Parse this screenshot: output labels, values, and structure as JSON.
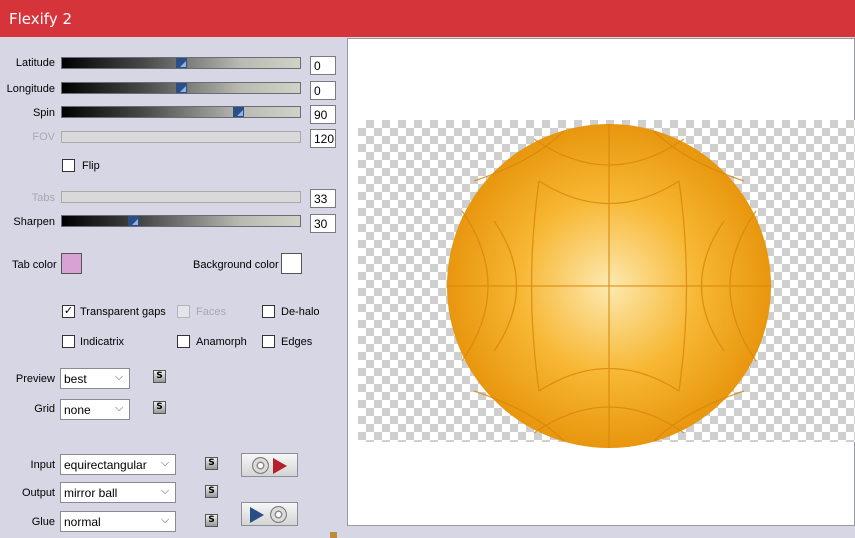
{
  "window": {
    "title": "Flexify 2"
  },
  "sliders": [
    {
      "label": "Latitude",
      "value": "0",
      "fraction": 0.5,
      "enabled": true
    },
    {
      "label": "Longitude",
      "value": "0",
      "fraction": 0.5,
      "enabled": true
    },
    {
      "label": "Spin",
      "value": "90",
      "fraction": 0.74,
      "enabled": true
    },
    {
      "label": "FOV",
      "value": "120",
      "fraction": null,
      "enabled": false
    },
    {
      "label": "Tabs",
      "value": "33",
      "fraction": null,
      "enabled": false
    },
    {
      "label": "Sharpen",
      "value": "30",
      "fraction": 0.3,
      "enabled": true
    }
  ],
  "flip": {
    "label": "Flip",
    "checked": false
  },
  "colors": {
    "tab_label": "Tab color",
    "tab_value": "#d8a3d4",
    "background_label": "Background color",
    "background_value": "#ffffff"
  },
  "options": {
    "transparent_gaps": {
      "label": "Transparent gaps",
      "checked": true
    },
    "faces": {
      "label": "Faces",
      "checked": false,
      "enabled": false
    },
    "de_halo": {
      "label": "De-halo",
      "checked": false
    },
    "indicatrix": {
      "label": "Indicatrix",
      "checked": false
    },
    "anamorph": {
      "label": "Anamorph",
      "checked": false
    },
    "edges": {
      "label": "Edges",
      "checked": false
    }
  },
  "selects": {
    "preview": {
      "label": "Preview",
      "value": "best"
    },
    "grid": {
      "label": "Grid",
      "value": "none"
    },
    "input": {
      "label": "Input",
      "value": "equirectangular"
    },
    "output": {
      "label": "Output",
      "value": "mirror ball"
    },
    "glue": {
      "label": "Glue",
      "value": "normal"
    }
  },
  "icons": {
    "s_button": "S",
    "dropdown": "⌵",
    "check": "✓"
  },
  "preview_colors": {
    "ball_light": "#fde9b0",
    "ball_mid": "#f7b733",
    "ball_dark": "#e8960e",
    "stroke": "#d8870a"
  }
}
